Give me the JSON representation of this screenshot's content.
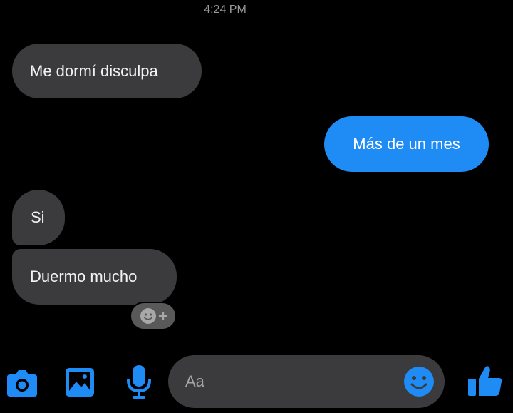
{
  "header": {
    "timestamp": "4:24 PM"
  },
  "messages": [
    {
      "direction": "received",
      "text": "Me dormí disculpa"
    },
    {
      "direction": "sent",
      "text": "Más de un mes"
    },
    {
      "direction": "received",
      "text": "Si"
    },
    {
      "direction": "received",
      "text": "Duermo mucho"
    }
  ],
  "reaction": {
    "icon": "smiley-add-icon",
    "symbol": "+"
  },
  "composer": {
    "placeholder": "Aa",
    "icons": [
      "camera-icon",
      "gallery-icon",
      "microphone-icon",
      "emoji-icon",
      "thumbs-up-icon"
    ]
  },
  "colors": {
    "background": "#000000",
    "received_bubble": "#3b3b3d",
    "sent_bubble": "#1f8bf4",
    "accent": "#1f8bf4",
    "timestamp": "#9a9a9a"
  }
}
